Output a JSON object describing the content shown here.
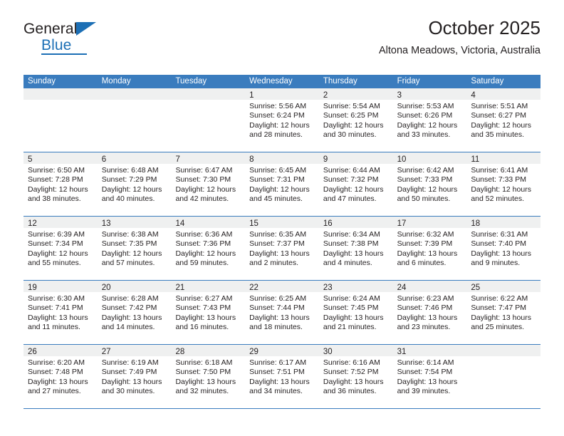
{
  "brand": {
    "name_top": "General",
    "name_bottom": "Blue",
    "accent_color": "#1c6fb5"
  },
  "header": {
    "title": "October 2025",
    "subtitle": "Altona Meadows, Victoria, Australia"
  },
  "calendar": {
    "header_bg": "#3a7cbe",
    "day_band_bg": "#eff0f0",
    "weekdays": [
      "Sunday",
      "Monday",
      "Tuesday",
      "Wednesday",
      "Thursday",
      "Friday",
      "Saturday"
    ],
    "weeks": [
      [
        {
          "day": "",
          "lines": []
        },
        {
          "day": "",
          "lines": []
        },
        {
          "day": "",
          "lines": []
        },
        {
          "day": "1",
          "lines": [
            "Sunrise: 5:56 AM",
            "Sunset: 6:24 PM",
            "Daylight: 12 hours",
            "and 28 minutes."
          ]
        },
        {
          "day": "2",
          "lines": [
            "Sunrise: 5:54 AM",
            "Sunset: 6:25 PM",
            "Daylight: 12 hours",
            "and 30 minutes."
          ]
        },
        {
          "day": "3",
          "lines": [
            "Sunrise: 5:53 AM",
            "Sunset: 6:26 PM",
            "Daylight: 12 hours",
            "and 33 minutes."
          ]
        },
        {
          "day": "4",
          "lines": [
            "Sunrise: 5:51 AM",
            "Sunset: 6:27 PM",
            "Daylight: 12 hours",
            "and 35 minutes."
          ]
        }
      ],
      [
        {
          "day": "5",
          "lines": [
            "Sunrise: 6:50 AM",
            "Sunset: 7:28 PM",
            "Daylight: 12 hours",
            "and 38 minutes."
          ]
        },
        {
          "day": "6",
          "lines": [
            "Sunrise: 6:48 AM",
            "Sunset: 7:29 PM",
            "Daylight: 12 hours",
            "and 40 minutes."
          ]
        },
        {
          "day": "7",
          "lines": [
            "Sunrise: 6:47 AM",
            "Sunset: 7:30 PM",
            "Daylight: 12 hours",
            "and 42 minutes."
          ]
        },
        {
          "day": "8",
          "lines": [
            "Sunrise: 6:45 AM",
            "Sunset: 7:31 PM",
            "Daylight: 12 hours",
            "and 45 minutes."
          ]
        },
        {
          "day": "9",
          "lines": [
            "Sunrise: 6:44 AM",
            "Sunset: 7:32 PM",
            "Daylight: 12 hours",
            "and 47 minutes."
          ]
        },
        {
          "day": "10",
          "lines": [
            "Sunrise: 6:42 AM",
            "Sunset: 7:33 PM",
            "Daylight: 12 hours",
            "and 50 minutes."
          ]
        },
        {
          "day": "11",
          "lines": [
            "Sunrise: 6:41 AM",
            "Sunset: 7:33 PM",
            "Daylight: 12 hours",
            "and 52 minutes."
          ]
        }
      ],
      [
        {
          "day": "12",
          "lines": [
            "Sunrise: 6:39 AM",
            "Sunset: 7:34 PM",
            "Daylight: 12 hours",
            "and 55 minutes."
          ]
        },
        {
          "day": "13",
          "lines": [
            "Sunrise: 6:38 AM",
            "Sunset: 7:35 PM",
            "Daylight: 12 hours",
            "and 57 minutes."
          ]
        },
        {
          "day": "14",
          "lines": [
            "Sunrise: 6:36 AM",
            "Sunset: 7:36 PM",
            "Daylight: 12 hours",
            "and 59 minutes."
          ]
        },
        {
          "day": "15",
          "lines": [
            "Sunrise: 6:35 AM",
            "Sunset: 7:37 PM",
            "Daylight: 13 hours",
            "and 2 minutes."
          ]
        },
        {
          "day": "16",
          "lines": [
            "Sunrise: 6:34 AM",
            "Sunset: 7:38 PM",
            "Daylight: 13 hours",
            "and 4 minutes."
          ]
        },
        {
          "day": "17",
          "lines": [
            "Sunrise: 6:32 AM",
            "Sunset: 7:39 PM",
            "Daylight: 13 hours",
            "and 6 minutes."
          ]
        },
        {
          "day": "18",
          "lines": [
            "Sunrise: 6:31 AM",
            "Sunset: 7:40 PM",
            "Daylight: 13 hours",
            "and 9 minutes."
          ]
        }
      ],
      [
        {
          "day": "19",
          "lines": [
            "Sunrise: 6:30 AM",
            "Sunset: 7:41 PM",
            "Daylight: 13 hours",
            "and 11 minutes."
          ]
        },
        {
          "day": "20",
          "lines": [
            "Sunrise: 6:28 AM",
            "Sunset: 7:42 PM",
            "Daylight: 13 hours",
            "and 14 minutes."
          ]
        },
        {
          "day": "21",
          "lines": [
            "Sunrise: 6:27 AM",
            "Sunset: 7:43 PM",
            "Daylight: 13 hours",
            "and 16 minutes."
          ]
        },
        {
          "day": "22",
          "lines": [
            "Sunrise: 6:25 AM",
            "Sunset: 7:44 PM",
            "Daylight: 13 hours",
            "and 18 minutes."
          ]
        },
        {
          "day": "23",
          "lines": [
            "Sunrise: 6:24 AM",
            "Sunset: 7:45 PM",
            "Daylight: 13 hours",
            "and 21 minutes."
          ]
        },
        {
          "day": "24",
          "lines": [
            "Sunrise: 6:23 AM",
            "Sunset: 7:46 PM",
            "Daylight: 13 hours",
            "and 23 minutes."
          ]
        },
        {
          "day": "25",
          "lines": [
            "Sunrise: 6:22 AM",
            "Sunset: 7:47 PM",
            "Daylight: 13 hours",
            "and 25 minutes."
          ]
        }
      ],
      [
        {
          "day": "26",
          "lines": [
            "Sunrise: 6:20 AM",
            "Sunset: 7:48 PM",
            "Daylight: 13 hours",
            "and 27 minutes."
          ]
        },
        {
          "day": "27",
          "lines": [
            "Sunrise: 6:19 AM",
            "Sunset: 7:49 PM",
            "Daylight: 13 hours",
            "and 30 minutes."
          ]
        },
        {
          "day": "28",
          "lines": [
            "Sunrise: 6:18 AM",
            "Sunset: 7:50 PM",
            "Daylight: 13 hours",
            "and 32 minutes."
          ]
        },
        {
          "day": "29",
          "lines": [
            "Sunrise: 6:17 AM",
            "Sunset: 7:51 PM",
            "Daylight: 13 hours",
            "and 34 minutes."
          ]
        },
        {
          "day": "30",
          "lines": [
            "Sunrise: 6:16 AM",
            "Sunset: 7:52 PM",
            "Daylight: 13 hours",
            "and 36 minutes."
          ]
        },
        {
          "day": "31",
          "lines": [
            "Sunrise: 6:14 AM",
            "Sunset: 7:54 PM",
            "Daylight: 13 hours",
            "and 39 minutes."
          ]
        },
        {
          "day": "",
          "lines": []
        }
      ]
    ]
  }
}
